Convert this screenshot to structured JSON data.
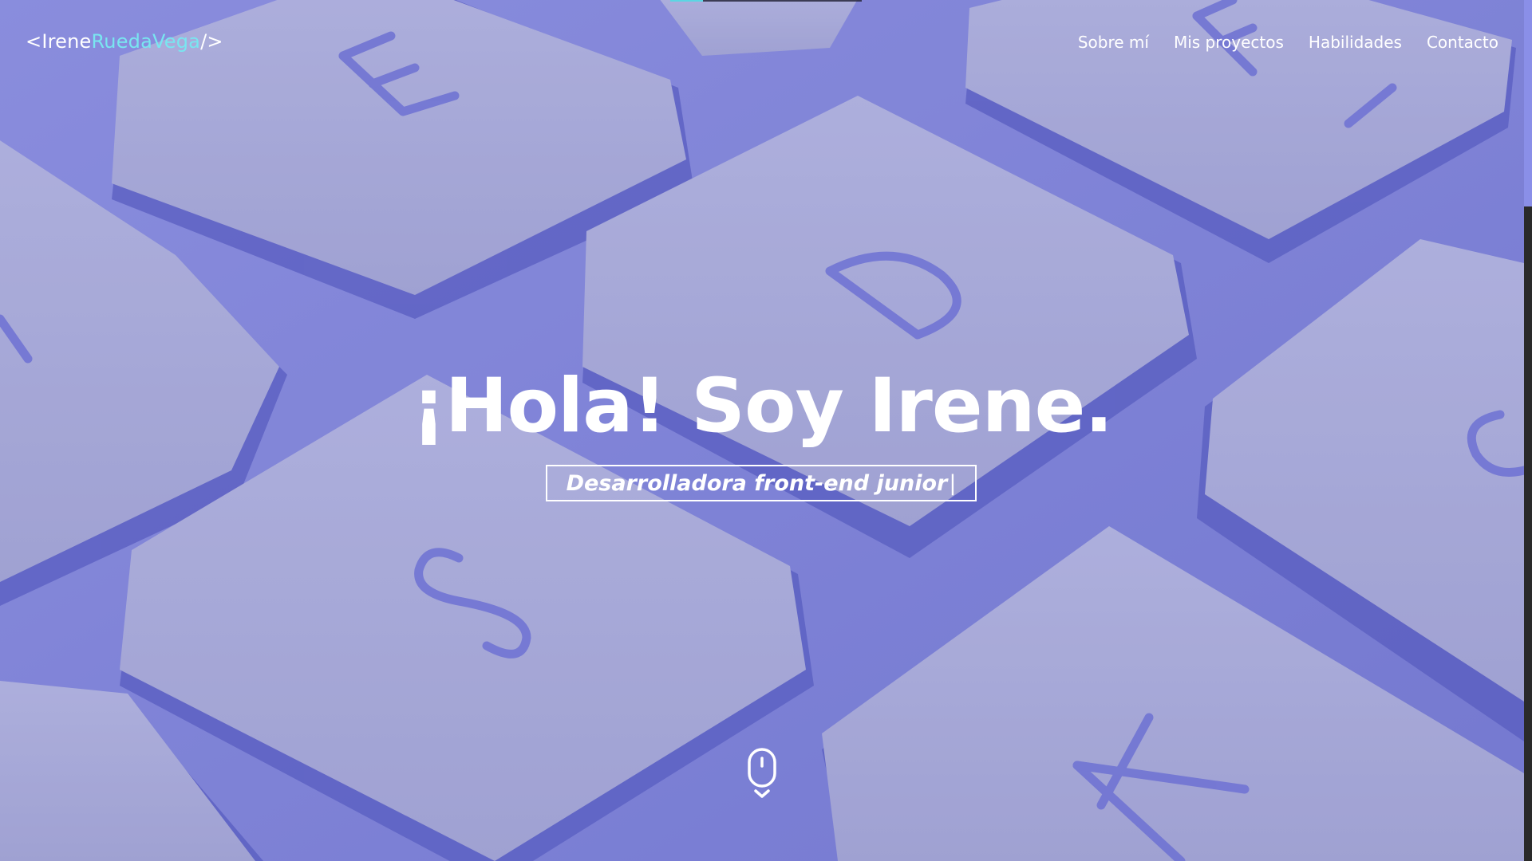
{
  "loading": {
    "progress": 0.17
  },
  "header": {
    "logo": {
      "open": "<",
      "first": "Irene",
      "middle": "RuedaVega",
      "close": "/>"
    },
    "nav": [
      {
        "label": "Sobre mí"
      },
      {
        "label": "Mis proyectos"
      },
      {
        "label": "Habilidades"
      },
      {
        "label": "Contacto"
      }
    ]
  },
  "hero": {
    "title": "¡Hola! Soy Irene.",
    "subtitle": "Desarrolladora front-end junior",
    "caret": "|",
    "scroll_icon": "mouse-scroll-icon",
    "background_keys": [
      "E",
      "F",
      "D",
      "S",
      "X"
    ]
  },
  "colors": {
    "accent": "#79e6f0",
    "overlay": "#7c7fd6",
    "text": "#ffffff"
  },
  "scroll": {
    "position": 0.0,
    "visible_fraction": 0.24
  }
}
